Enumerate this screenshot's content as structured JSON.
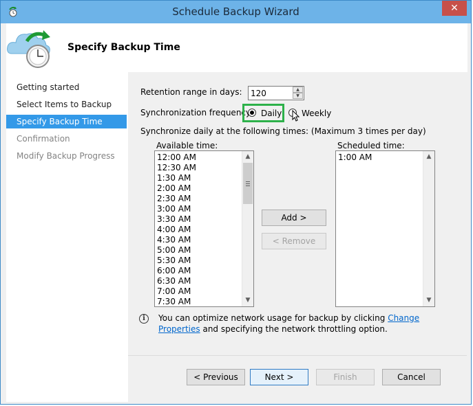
{
  "window": {
    "title": "Schedule Backup Wizard",
    "close_label": "✕"
  },
  "header": {
    "title": "Specify Backup Time",
    "icon": "backup-clock-icon"
  },
  "nav": {
    "items": [
      {
        "label": "Getting started",
        "state": "normal"
      },
      {
        "label": "Select Items to Backup",
        "state": "normal"
      },
      {
        "label": "Specify Backup Time",
        "state": "active"
      },
      {
        "label": "Confirmation",
        "state": "disabled"
      },
      {
        "label": "Modify Backup Progress",
        "state": "disabled"
      }
    ]
  },
  "form": {
    "retention_label": "Retention range in days:",
    "retention_value": "120",
    "sync_label": "Synchronization frequency:",
    "daily_label": "Daily",
    "weekly_label": "Weekly",
    "selected_frequency": "Daily",
    "sync_times_label": "Synchronize daily at the following times: (Maximum 3 times per day)",
    "available_label": "Available time:",
    "scheduled_label": "Scheduled time:",
    "available_times": [
      "12:00 AM",
      "12:30 AM",
      "1:30 AM",
      "2:00 AM",
      "2:30 AM",
      "3:00 AM",
      "3:30 AM",
      "4:00 AM",
      "4:30 AM",
      "5:00 AM",
      "5:30 AM",
      "6:00 AM",
      "6:30 AM",
      "7:00 AM",
      "7:30 AM"
    ],
    "scheduled_times": [
      "1:00 AM"
    ],
    "add_label": "Add >",
    "remove_label": "< Remove"
  },
  "info": {
    "text_before": "You can optimize network usage for backup by clicking ",
    "link_text": "Change Properties",
    "text_after": " and specifying the network throttling option."
  },
  "footer": {
    "previous_label": "< Previous",
    "next_label": "Next >",
    "finish_label": "Finish",
    "cancel_label": "Cancel"
  },
  "colors": {
    "titlebar": "#6db3e8",
    "active_nav": "#3399e8",
    "highlight": "#2db14a",
    "close": "#c7504a"
  }
}
